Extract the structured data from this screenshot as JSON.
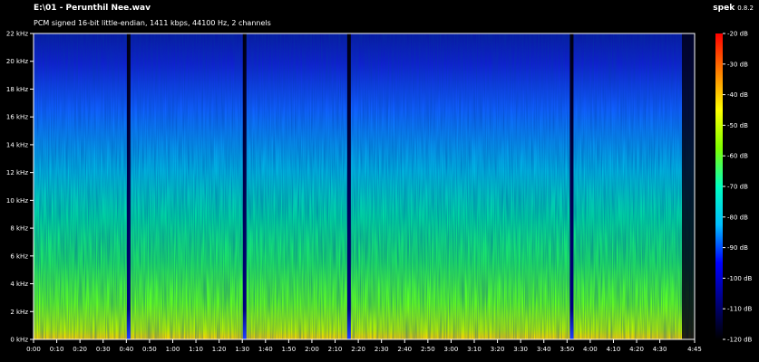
{
  "window": {
    "file_title": "E:\\01 - Perunthil Nee.wav",
    "format_info": "PCM signed 16-bit little-endian, 1411 kbps, 44100 Hz, 2 channels",
    "app_name": "spek",
    "app_version": "0.8.2"
  },
  "chart_data": {
    "type": "heatmap",
    "title": "E:\\01 - Perunthil Nee.wav",
    "subtitle": "PCM signed 16-bit little-endian, 1411 kbps, 44100 Hz, 2 channels",
    "x_axis": {
      "unit": "time",
      "range_seconds": [
        0,
        285
      ],
      "tick_labels": [
        "0:00",
        "0:10",
        "0:20",
        "0:30",
        "0:40",
        "0:50",
        "1:00",
        "1:10",
        "1:20",
        "1:30",
        "1:40",
        "1:50",
        "2:00",
        "2:10",
        "2:20",
        "2:30",
        "2:40",
        "2:50",
        "3:00",
        "3:10",
        "3:20",
        "3:30",
        "3:40",
        "3:50",
        "4:00",
        "4:10",
        "4:20",
        "4:30",
        "4:45"
      ],
      "tick_seconds": [
        0,
        10,
        20,
        30,
        40,
        50,
        60,
        70,
        80,
        90,
        100,
        110,
        120,
        130,
        140,
        150,
        160,
        170,
        180,
        190,
        200,
        210,
        220,
        230,
        240,
        250,
        260,
        270,
        285
      ]
    },
    "y_axis": {
      "unit": "kHz",
      "range": [
        0,
        22
      ],
      "tick_labels": [
        "0 kHz",
        "2 kHz",
        "4 kHz",
        "6 kHz",
        "8 kHz",
        "10 kHz",
        "12 kHz",
        "14 kHz",
        "16 kHz",
        "18 kHz",
        "20 kHz",
        "22 kHz"
      ],
      "tick_values": [
        0,
        2,
        4,
        6,
        8,
        10,
        12,
        14,
        16,
        18,
        20,
        22
      ]
    },
    "colorbar": {
      "unit": "dB",
      "range": [
        -120,
        -20
      ],
      "tick_labels": [
        "-20 dB",
        "-30 dB",
        "-40 dB",
        "-50 dB",
        "-60 dB",
        "-70 dB",
        "-80 dB",
        "-90 dB",
        "-100 dB",
        "-110 dB",
        "-120 dB"
      ],
      "tick_values": [
        -20,
        -30,
        -40,
        -50,
        -60,
        -70,
        -80,
        -90,
        -100,
        -110,
        -120
      ],
      "colors": [
        "#000000",
        "#00007f",
        "#0000ff",
        "#00bfff",
        "#00ffbf",
        "#7fff00",
        "#ffff00",
        "#ff7f00",
        "#ff0000"
      ]
    },
    "silence_gaps_seconds": [
      41,
      91,
      136,
      232
    ],
    "grid": false
  }
}
